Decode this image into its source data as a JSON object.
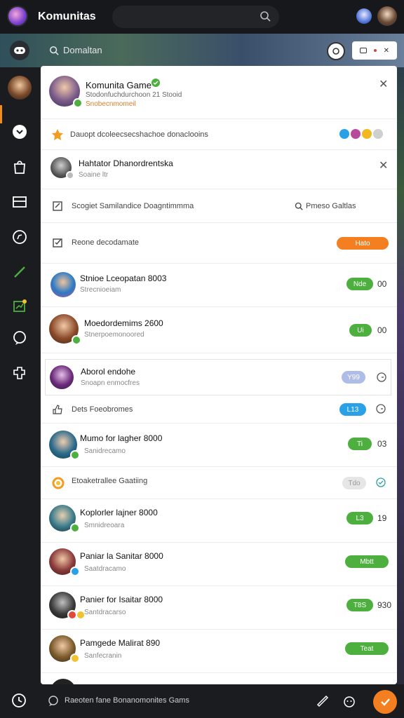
{
  "app": {
    "title": "Komunitas"
  },
  "hero": {
    "search_label": "Domaltan"
  },
  "header_card": {
    "title": "Komunita Game",
    "subtitle": "Stodonfuchdurchoon 21 Stooid",
    "status": "Snobecnmomeil"
  },
  "rows": [
    {
      "type": "notice",
      "text": "Dauopt dcoleecsecshachoe donaclooins"
    },
    {
      "type": "person_dismiss",
      "title": "Hahtator Dhanordrentska",
      "sub": "Soaine ltr"
    },
    {
      "type": "search",
      "left": "Scogiet Samilandice Doagntimmma",
      "right": "Pmeso Galtlas"
    },
    {
      "type": "action",
      "text": "Reone decodamate",
      "pill": "Hato"
    },
    {
      "type": "user",
      "title": "Stnioe Lceopatan 8003",
      "sub": "Strecnioeiam",
      "pill": "Nde",
      "trail": "00",
      "pill_color": "#4caf3e"
    },
    {
      "type": "user",
      "title": "Moedordemims 2600",
      "sub": "Stnerpoemonoored",
      "pill": "Ui",
      "trail": "00",
      "pill_color": "#4caf3e"
    },
    {
      "type": "user",
      "title": "Aborol endohe",
      "sub": "Snoapn enmocfres",
      "pill": "Y99",
      "trail": "",
      "pill_color": "#aebce8"
    },
    {
      "type": "action",
      "text": "Dets Foeobromes",
      "pill": "L13",
      "trail": "",
      "pill_color": "#2aa0e6"
    },
    {
      "type": "user",
      "title": "Mumo for lagher 8000",
      "sub": "Sanidrecamo",
      "pill": "Ti",
      "trail": "03",
      "pill_color": "#4caf3e"
    },
    {
      "type": "action",
      "text": "Etoaketrallee Gaatiing",
      "pill": "Tdo",
      "trail": "",
      "pill_color": "#e6e6e6"
    },
    {
      "type": "user",
      "title": "Koplorler lajner 8000",
      "sub": "Smnidreoara",
      "pill": "L3",
      "trail": "19",
      "pill_color": "#4caf3e"
    },
    {
      "type": "user",
      "title": "Paniar la Sanitar 8000",
      "sub": "Saatdracamo",
      "pill": "Mbtt",
      "trail": "",
      "pill_color": "#4caf3e"
    },
    {
      "type": "user",
      "title": "Panier for Isaitar 8000",
      "sub": "Santdracarso",
      "pill": "T8S",
      "trail": "930",
      "pill_color": "#4caf3e"
    },
    {
      "type": "user",
      "title": "Pamgede Malirat 890",
      "sub": "Sanfecranin",
      "pill": "Teat",
      "trail": "",
      "pill_color": "#4caf3e"
    }
  ],
  "bottom": {
    "label": "Raeoten fane Bonanomonites Gams"
  },
  "colors": {
    "accent": "#f47f20",
    "green": "#4caf3e",
    "blue": "#2aa0e6",
    "bg": "#1d1f22"
  }
}
